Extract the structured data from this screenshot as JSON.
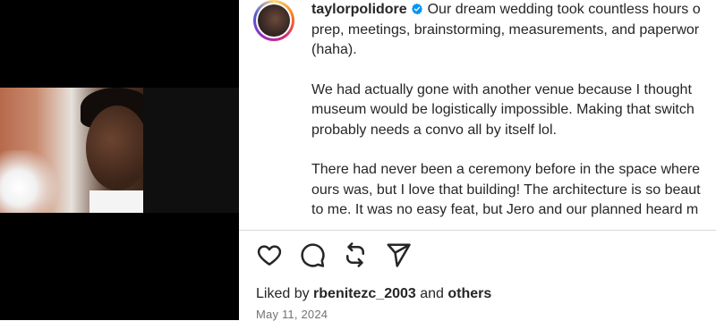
{
  "post": {
    "username": "taylorpolidore",
    "caption_lines": [
      "Our dream wedding took countless hours o",
      "prep, meetings, brainstorming, measurements, and paperwor",
      "(haha).",
      "",
      "We had actually gone with another venue because I thought",
      "museum would be logistically impossible. Making that switch",
      "probably needs a convo all by itself lol.",
      "",
      "There had never been a ceremony before in the space where",
      "ours was, but I love that building! The architecture is so beaut",
      "to me. It was no easy feat, but Jero and our planned heard m"
    ],
    "likes": {
      "prefix": "Liked by",
      "user": "rbenitezc_2003",
      "conj": "and",
      "others": "others"
    },
    "date": "May 11, 2024"
  },
  "icons": {
    "verified": "verified-badge-icon",
    "like": "heart-icon",
    "comment": "comment-icon",
    "share": "repost-icon",
    "send": "send-icon"
  },
  "colors": {
    "verified": "#0095f6",
    "text": "#262626",
    "muted": "#737373"
  }
}
